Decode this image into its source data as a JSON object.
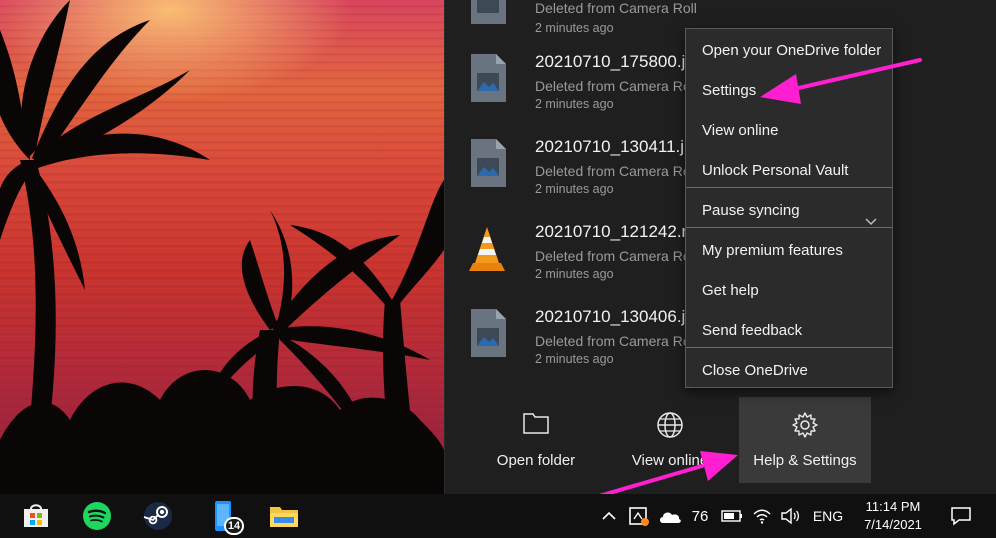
{
  "files": [
    {
      "name": "",
      "status": "Deleted from Camera Roll",
      "time": "2 minutes ago",
      "icon": "image-file-icon"
    },
    {
      "name": "20210710_175800.jpg",
      "status": "Deleted from Camera Roll",
      "time": "2 minutes ago",
      "icon": "image-file-icon"
    },
    {
      "name": "20210710_130411.jpg",
      "status": "Deleted from Camera Roll",
      "time": "2 minutes ago",
      "icon": "image-file-icon"
    },
    {
      "name": "20210710_121242.mp4",
      "status": "Deleted from Camera Roll",
      "time": "2 minutes ago",
      "icon": "vlc-icon"
    },
    {
      "name": "20210710_130406.jpg",
      "status": "Deleted from Camera Roll",
      "time": "2 minutes ago",
      "icon": "image-file-icon"
    }
  ],
  "menu": {
    "open_folder": "Open your OneDrive folder",
    "settings": "Settings",
    "view_online": "View online",
    "unlock_vault": "Unlock Personal Vault",
    "pause_syncing": "Pause syncing",
    "premium": "My premium features",
    "get_help": "Get help",
    "send_feedback": "Send feedback",
    "close": "Close OneDrive"
  },
  "bottom_bar": {
    "open_folder": "Open folder",
    "view_online": "View online",
    "help_settings": "Help & Settings"
  },
  "taskbar": {
    "apps": [
      "store-icon",
      "spotify-icon",
      "steam-icon",
      "phone-icon",
      "file-explorer-icon"
    ],
    "phone_badge": "14",
    "temperature": "76",
    "language": "ENG",
    "time": "11:14 PM",
    "date": "7/14/2021"
  },
  "colors": {
    "flyout_bg": "#1f1f1f",
    "menu_bg": "#2b2b2b",
    "annotation_arrow": "#ff1fd0",
    "taskbar_bg": "#101010"
  }
}
